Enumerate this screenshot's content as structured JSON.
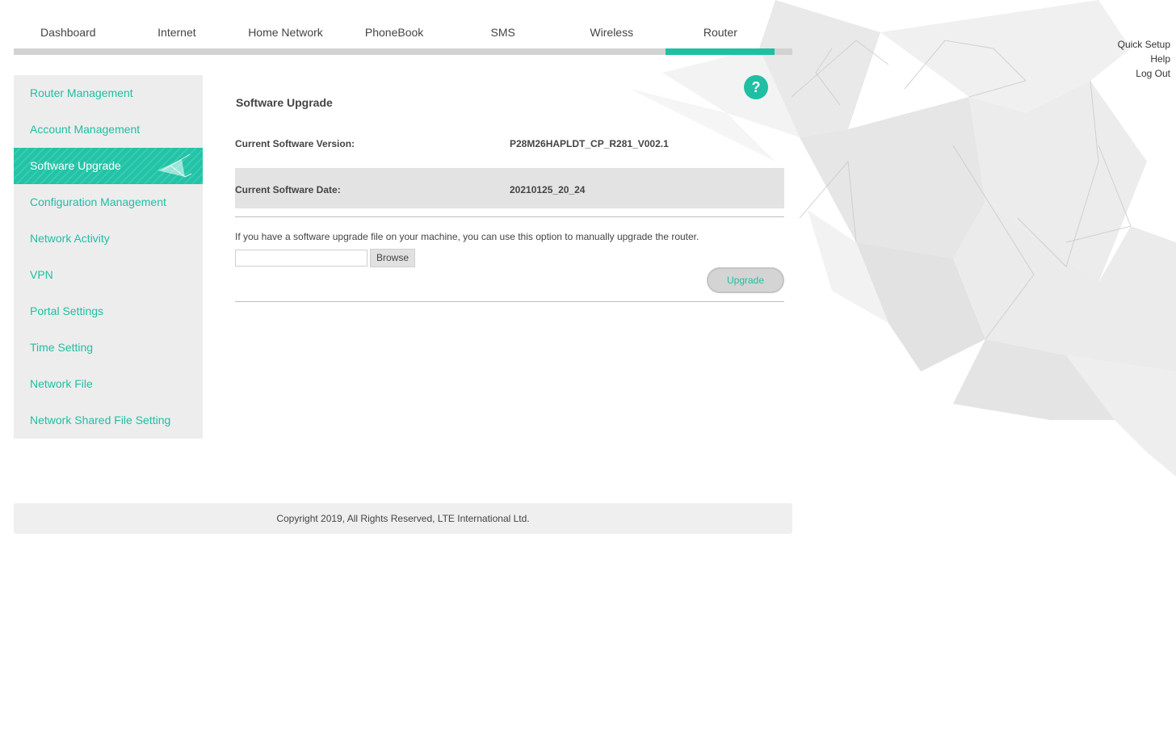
{
  "nav": {
    "items": [
      {
        "label": "Dashboard"
      },
      {
        "label": "Internet"
      },
      {
        "label": "Home Network"
      },
      {
        "label": "PhoneBook"
      },
      {
        "label": "SMS"
      },
      {
        "label": "Wireless"
      },
      {
        "label": "Router"
      }
    ],
    "active": "Router"
  },
  "top_links": {
    "quick_setup": "Quick Setup",
    "help": "Help",
    "logout": "Log Out"
  },
  "sidebar": {
    "items": [
      {
        "label": "Router Management"
      },
      {
        "label": "Account Management"
      },
      {
        "label": "Software Upgrade"
      },
      {
        "label": "Configuration Management"
      },
      {
        "label": "Network Activity"
      },
      {
        "label": "VPN"
      },
      {
        "label": "Portal Settings"
      },
      {
        "label": "Time Setting"
      },
      {
        "label": "Network File"
      },
      {
        "label": "Network Shared File Setting"
      }
    ],
    "active": "Software Upgrade"
  },
  "help_icon": {
    "glyph": "?"
  },
  "main": {
    "title": "Software Upgrade",
    "version_label": "Current Software Version:",
    "version_value": "P28M26HAPLDT_CP_R281_V002.1",
    "date_label": "Current Software Date:",
    "date_value": "20210125_20_24",
    "description": "If you have a software upgrade file on your machine, you can use this option to manually upgrade the router.",
    "file_input_value": "",
    "browse_label": "Browse",
    "upgrade_label": "Upgrade"
  },
  "footer": {
    "copyright": "Copyright 2019, All Rights Reserved, LTE International Ltd."
  },
  "colors": {
    "accent": "#1fbfa3",
    "nav_bar": "#d2d2d2",
    "sidebar_bg": "#ededed"
  }
}
